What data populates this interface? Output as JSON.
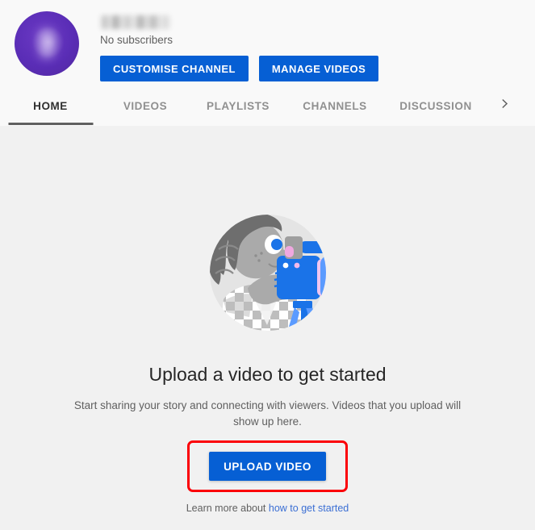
{
  "channel": {
    "name_redacted": "",
    "avatar_color": "#5a2db6",
    "subscribers": "No subscribers",
    "buttons": {
      "customise": "CUSTOMISE CHANNEL",
      "manage": "MANAGE VIDEOS"
    }
  },
  "tabs": {
    "items": [
      {
        "label": "HOME",
        "active": true
      },
      {
        "label": "VIDEOS",
        "active": false
      },
      {
        "label": "PLAYLISTS",
        "active": false
      },
      {
        "label": "CHANNELS",
        "active": false
      },
      {
        "label": "DISCUSSION",
        "active": false
      }
    ],
    "overflow_icon": "chevron-right-icon"
  },
  "empty_state": {
    "illustration": "person-filming-with-camcorder-illustration",
    "title": "Upload a video to get started",
    "subtitle": "Start sharing your story and connecting with viewers. Videos that you upload will show up here.",
    "upload_button": "UPLOAD VIDEO",
    "learn_more_prefix": "Learn more about ",
    "learn_more_link": "how to get started"
  },
  "annotation": {
    "highlight_color": "#fb0007",
    "target": "upload-video-button"
  },
  "theme": {
    "accent_blue": "#065fd4",
    "link_blue": "#3b6fd4",
    "page_background": "#f1f1f1",
    "header_background": "#f9f9f9",
    "text_primary": "#262626",
    "text_secondary": "#606060"
  }
}
